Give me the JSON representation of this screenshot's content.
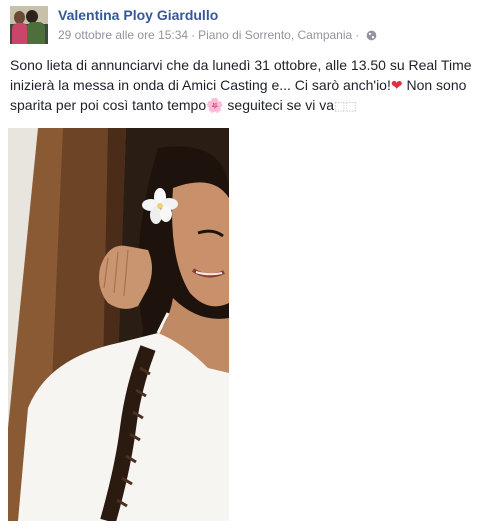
{
  "post": {
    "author": "Valentina Ploy Giardullo",
    "timestamp": "29 ottobre alle ore 15:34",
    "separator": "·",
    "location": "Piano di Sorrento, Campania",
    "privacy_icon": "globe-icon",
    "message": {
      "part1": "Sono lieta di annunciarvi che da lunedì 31 ottobre, alle 13.50 su Real Time inizierà la messa in onda di Amici Casting e... Ci sarò anch'io!",
      "heart": "❤",
      "part2": " Non sono sparita per poi così tanto tempo",
      "flower": "🌸",
      "part3": " seguiteci se vi va",
      "trailing_glyphs": "⬚⬚"
    },
    "photo_icon": "post-photo"
  },
  "colors": {
    "link": "#365899",
    "meta": "#90949c",
    "text": "#1d2129",
    "heart": "#dd2e44"
  }
}
